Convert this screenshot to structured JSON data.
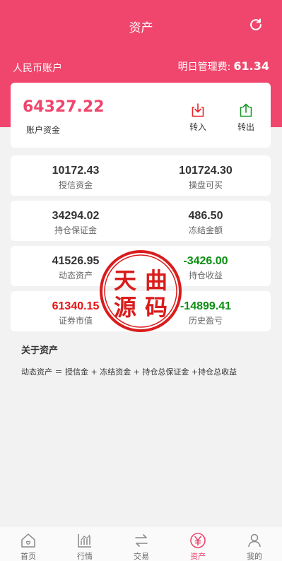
{
  "header": {
    "title": "资产",
    "account_label": "人民币账户",
    "fee_label": "明日管理费:",
    "fee_value": "61.34"
  },
  "balance": {
    "amount": "64327.22",
    "label": "账户资金",
    "transfer_in": "转入",
    "transfer_out": "转出"
  },
  "stats": [
    {
      "left": {
        "value": "10172.43",
        "label": "授信资金"
      },
      "right": {
        "value": "101724.30",
        "label": "操盘可买"
      }
    },
    {
      "left": {
        "value": "34294.02",
        "label": "持仓保证金"
      },
      "right": {
        "value": "486.50",
        "label": "冻结金额"
      }
    },
    {
      "left": {
        "value": "41526.95",
        "label": "动态资产"
      },
      "right": {
        "value": "-3426.00",
        "label": "持仓收益"
      }
    },
    {
      "left": {
        "value": "61340.15",
        "label": "证券市值"
      },
      "right": {
        "value": "-14899.41",
        "label": "历史盈亏"
      }
    }
  ],
  "about": {
    "title": "关于资产",
    "formula": "动态资产 ＝ 授信金 + 冻结资金 + 持仓总保证金 +持仓总收益"
  },
  "watermark": {
    "text": "天曲源码",
    "color": "#d91c1c"
  },
  "tabs": [
    {
      "label": "首页",
      "icon": "home-icon"
    },
    {
      "label": "行情",
      "icon": "chart-icon"
    },
    {
      "label": "交易",
      "icon": "exchange-icon"
    },
    {
      "label": "资产",
      "icon": "yen-icon",
      "active": true
    },
    {
      "label": "我的",
      "icon": "user-icon"
    }
  ],
  "colors": {
    "brand": "#f0456c",
    "positive": "#e81010",
    "negative": "#0a8f10",
    "transfer_in_icon": "#e8262c",
    "transfer_out_icon": "#1a9a2a"
  }
}
